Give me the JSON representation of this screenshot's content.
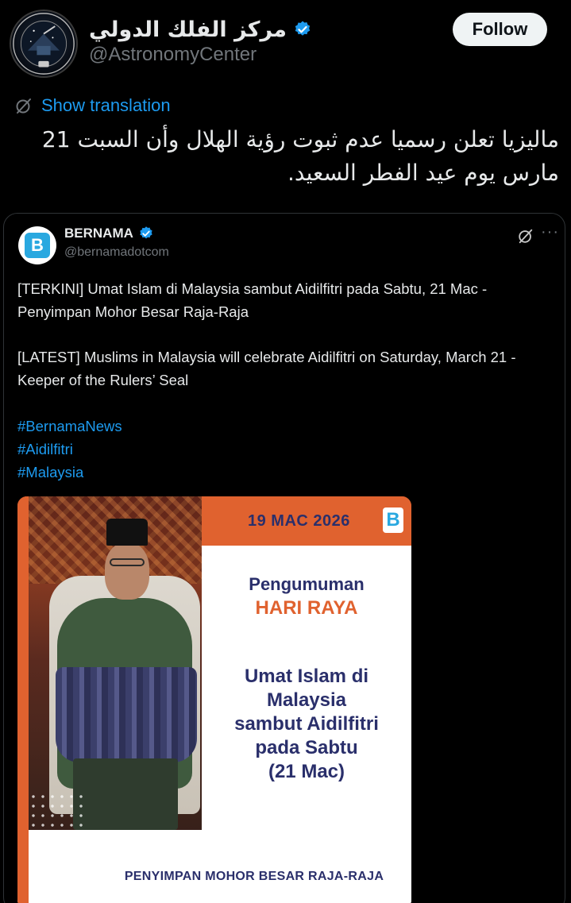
{
  "author": {
    "display_name": "مركز الفلك الدولي",
    "handle": "@AstronomyCenter",
    "verified": true,
    "avatar_icon": "observatory-logo-icon"
  },
  "follow_label": "Follow",
  "translate": {
    "label": "Show translation",
    "icon": "grok-translate-icon"
  },
  "post_text": "ماليزيا تعلن رسميا عدم ثبوت رؤية الهلال وأن السبت 21 مارس يوم عيد الفطر السعيد.",
  "quoted": {
    "display_name": "BERNAMA",
    "handle": "@bernamadotcom",
    "verified": true,
    "avatar_letter": "B",
    "more_label": "···",
    "paragraph_malay": "[TERKINI] Umat Islam di Malaysia sambut Aidilfitri pada Sabtu, 21 Mac - Penyimpan Mohor Besar Raja-Raja",
    "paragraph_english": "[LATEST] Muslims in Malaysia will celebrate Aidilfitri on Saturday, March 21 - Keeper of the Rulers’ Seal",
    "hashtags": [
      "#BernamaNews",
      "#Aidilfitri",
      "#Malaysia"
    ],
    "media": {
      "date": "19 MAC 2026",
      "logo_letter": "B",
      "announcement": "Pengumuman",
      "hari_raya": "HARI RAYA",
      "message_lines": [
        "Umat Islam di",
        "Malaysia",
        "sambut Aidilfitri",
        "pada Sabtu",
        "(21 Mac)"
      ],
      "keeper": "PENYIMPAN MOHOR BESAR RAJA-RAJA",
      "accent_color": "#e0622f",
      "navy_color": "#2a2f6b"
    }
  },
  "colors": {
    "background": "#000000",
    "link": "#1d9bf0",
    "text": "#e7e9ea",
    "muted": "#71767b"
  }
}
